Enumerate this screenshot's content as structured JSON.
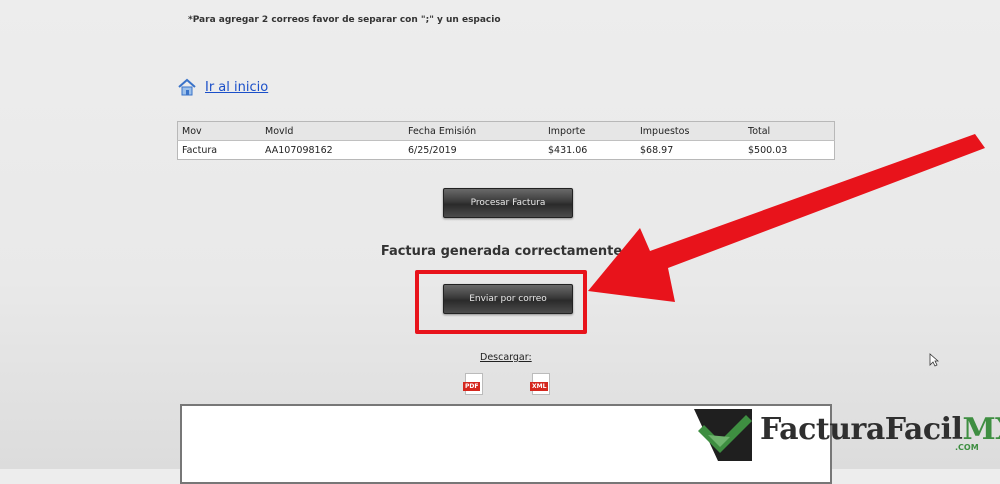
{
  "note": "*Para agregar 2 correos favor de separar con \";\" y un espacio",
  "home_link": "Ir al inicio",
  "table": {
    "headers": [
      "Mov",
      "MovId",
      "Fecha Emisión",
      "Importe",
      "Impuestos",
      "Total"
    ],
    "rows": [
      [
        "Factura",
        "AA107098162",
        "6/25/2019",
        "$431.06",
        "$68.97",
        "$500.03"
      ]
    ]
  },
  "buttons": {
    "procesar": "Procesar Factura",
    "enviar": "Enviar por correo"
  },
  "success_message": "Factura generada correctamente.",
  "download": {
    "label": "Descargar:",
    "pdf": "PDF",
    "xml": "XML"
  },
  "logo": {
    "text_main": "FacturaFacil",
    "text_accent": "MX",
    "domain": ".COM"
  },
  "colors": {
    "highlight": "#e8131b",
    "link": "#1a4fc9",
    "brand_green": "#3e8e41"
  }
}
